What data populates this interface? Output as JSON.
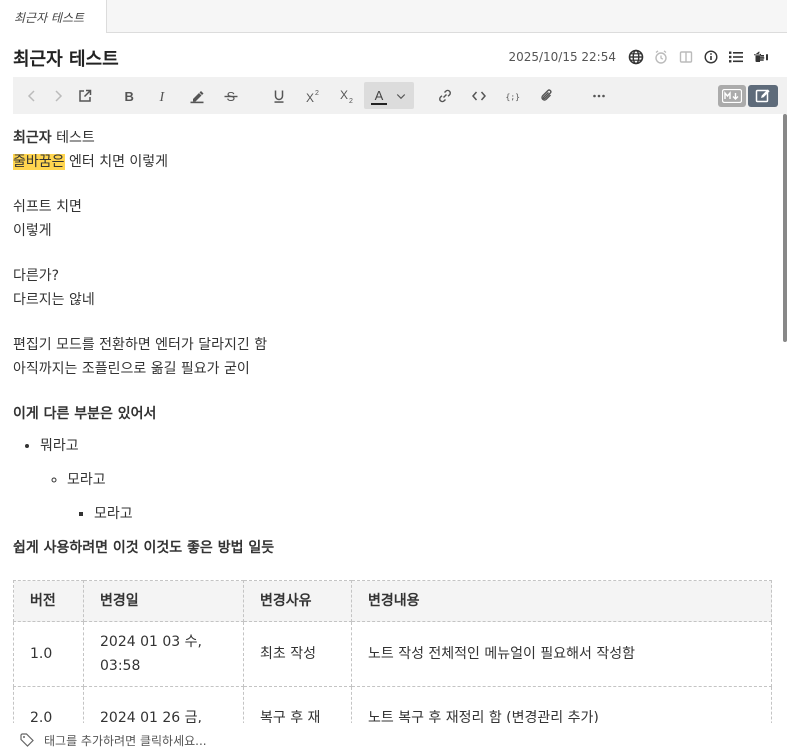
{
  "tab": {
    "label": "최근자 테스트"
  },
  "note": {
    "title": "최근자 테스트",
    "date": "2025/10/15 22:54"
  },
  "toolbar": {
    "color_label": "A"
  },
  "content": {
    "line1_bold": "최근자",
    "line1_rest": " 테스트",
    "line2_hl": "줄바꿈은",
    "line2_rest": " 엔터 치면 이렇게",
    "line3": "쉬프트 치면",
    "line4": "이렇게",
    "line5": "다른가?",
    "line6": "다르지는 않네",
    "line7": "편집기 모드를 전환하면 엔터가 달라지긴 함",
    "line8": "아직까지는 조플린으로 옮길 필요가 굳이",
    "heading1": "이게 다른 부분은 있어서",
    "list": {
      "item1": "뭐라고",
      "item2": "모라고",
      "item3": "모라고"
    },
    "heading2": "쉽게 사용하려면 이것 이것도 좋은 방법 일듯"
  },
  "table": {
    "headers": [
      "버전",
      "변경일",
      "변경사유",
      "변경내용"
    ],
    "rows": [
      [
        "1.0",
        "2024 01 03 수, 03:58",
        "최초 작성",
        "노트 작성 전체적인 메뉴얼이 필요해서 작성함"
      ],
      [
        "2.0",
        "2024 01 26 금,",
        "복구 후 재",
        "노트 복구 후 재정리 함 (변경관리 추가)"
      ]
    ]
  },
  "tags": {
    "placeholder": "태그를 추가하려면 클릭하세요..."
  }
}
